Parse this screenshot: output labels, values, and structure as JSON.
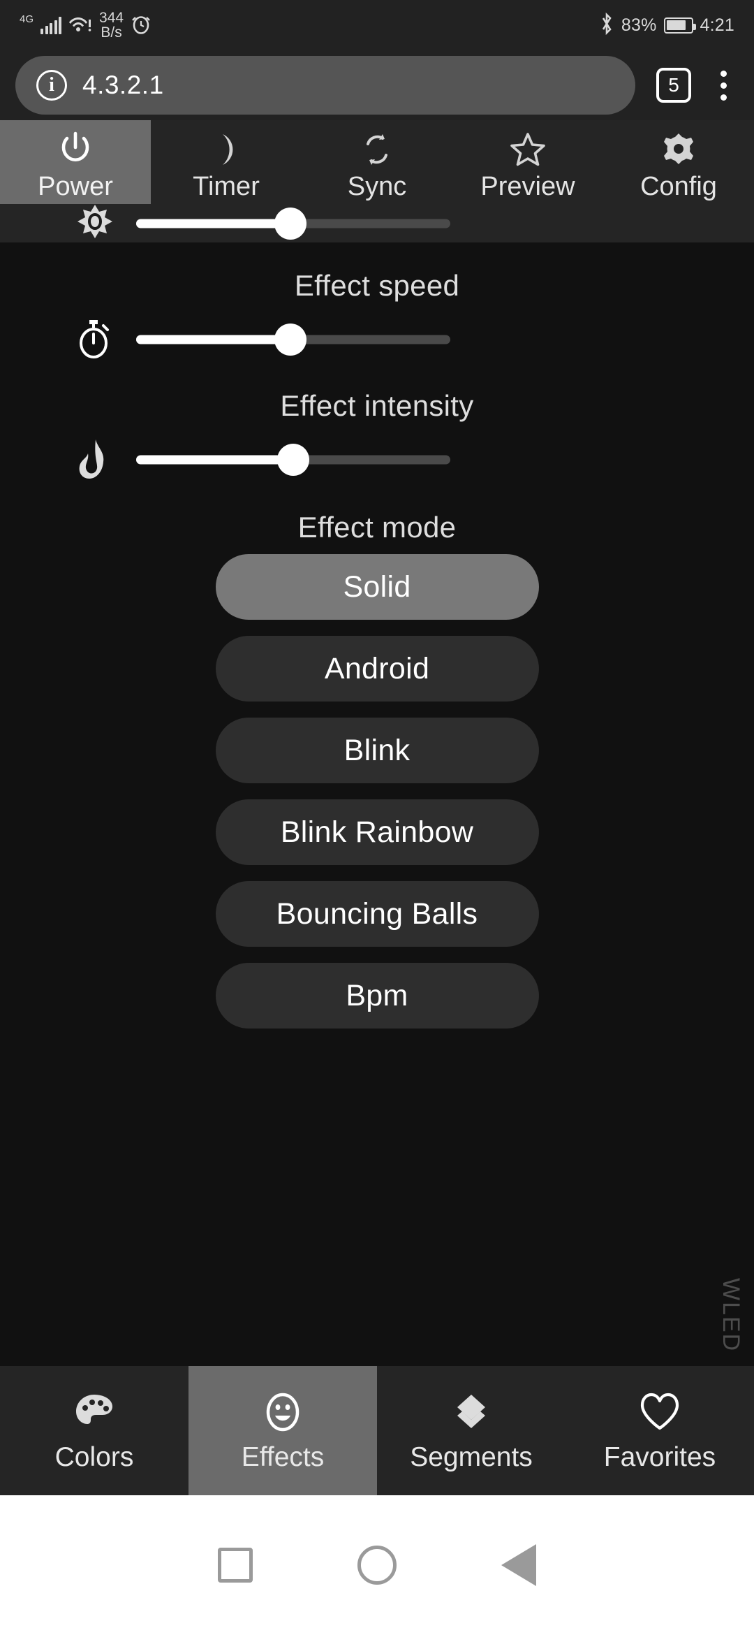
{
  "statusbar": {
    "network_type": "4G",
    "data_rate_value": "344",
    "data_rate_unit": "B/s",
    "battery_percent": "83%",
    "clock": "4:21",
    "icons": [
      "signal-bars-icon",
      "wifi-warning-icon",
      "alarm-clock-icon",
      "bluetooth-icon",
      "battery-icon"
    ]
  },
  "browser": {
    "url": "4.3.2.1",
    "tab_count": "5",
    "info_glyph": "i",
    "icons": [
      "page-info-icon",
      "tab-switcher-icon",
      "overflow-menu-icon"
    ]
  },
  "topnav": {
    "items": [
      {
        "label": "Power",
        "icon": "power-icon",
        "active": true
      },
      {
        "label": "Timer",
        "icon": "moon-icon",
        "active": false
      },
      {
        "label": "Sync",
        "icon": "sync-icon",
        "active": false
      },
      {
        "label": "Preview",
        "icon": "star-icon",
        "active": false
      },
      {
        "label": "Config",
        "icon": "gear-icon",
        "active": false
      }
    ],
    "brightness": {
      "icon": "brightness-sun-icon",
      "value": 49
    }
  },
  "main": {
    "effect_speed": {
      "label": "Effect speed",
      "icon": "stopwatch-icon",
      "value": 49
    },
    "effect_intensity": {
      "label": "Effect intensity",
      "icon": "flame-icon",
      "value": 50
    },
    "effect_mode": {
      "label": "Effect mode"
    },
    "effects": [
      {
        "name": "Solid",
        "selected": true
      },
      {
        "name": "Android",
        "selected": false
      },
      {
        "name": "Blink",
        "selected": false
      },
      {
        "name": "Blink Rainbow",
        "selected": false
      },
      {
        "name": "Bouncing Balls",
        "selected": false
      },
      {
        "name": "Bpm",
        "selected": false
      }
    ],
    "watermark": "WLED"
  },
  "tabbar": {
    "items": [
      {
        "label": "Colors",
        "icon": "palette-icon",
        "active": false
      },
      {
        "label": "Effects",
        "icon": "smiley-icon",
        "active": true
      },
      {
        "label": "Segments",
        "icon": "layers-icon",
        "active": false
      },
      {
        "label": "Favorites",
        "icon": "heart-icon",
        "active": false
      }
    ]
  },
  "system_nav": {
    "items": [
      {
        "icon": "recents-square-icon"
      },
      {
        "icon": "home-circle-icon"
      },
      {
        "icon": "back-triangle-icon"
      }
    ]
  },
  "colors": {
    "page_bg": "#111111",
    "bar_bg": "#252525",
    "active_tab": "#6b6b6b",
    "button_bg": "#2e2e2e",
    "button_selected": "#797979",
    "accent_white": "#ffffff",
    "track_inactive": "#4a4a4a"
  }
}
